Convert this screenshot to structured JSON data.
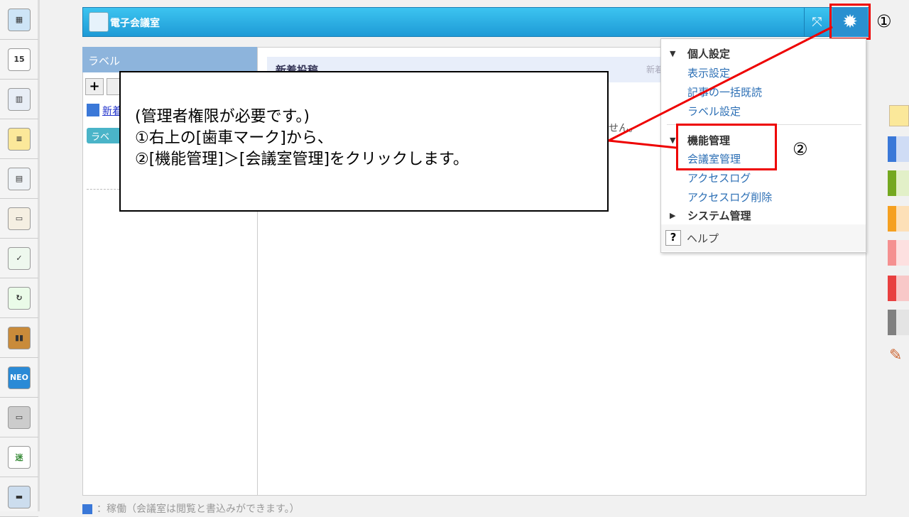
{
  "app": {
    "title": "電子会議室"
  },
  "sidebar": {
    "section_title": "ラベル",
    "new_link": "新着",
    "tree_label": "ラベル"
  },
  "main": {
    "news_header": "新着投稿",
    "news_right": "新着",
    "empty_text": "せん。"
  },
  "callout": {
    "lines": [
      "(管理者権限が必要です。)",
      "①右上の[歯車マーク]から、",
      "②[機能管理]＞[会議室管理]をクリックします。"
    ]
  },
  "markers": {
    "one": "①",
    "two": "②"
  },
  "menu": {
    "personal": {
      "label": "個人設定",
      "items": [
        "表示設定",
        "記事の一括既読",
        "ラベル設定"
      ]
    },
    "function": {
      "label": "機能管理",
      "items": [
        "会議室管理",
        "アクセスログ",
        "アクセスログ削除"
      ]
    },
    "system": {
      "label": "システム管理"
    },
    "help": "ヘルプ"
  },
  "leftbar": {
    "calendar_day": "15",
    "neo_label": "NEO"
  },
  "footer": {
    "legend_text": "：稼働（会議室は閲覧と書込みができます。）"
  },
  "colors": {
    "header": "#1e9ad6",
    "highlight": "#ee0000",
    "link": "#2c6fb5"
  },
  "right_swatches": [
    "#3a78d8",
    "#74a820",
    "#f5a020",
    "#f59090",
    "#e84040",
    "#808080"
  ]
}
